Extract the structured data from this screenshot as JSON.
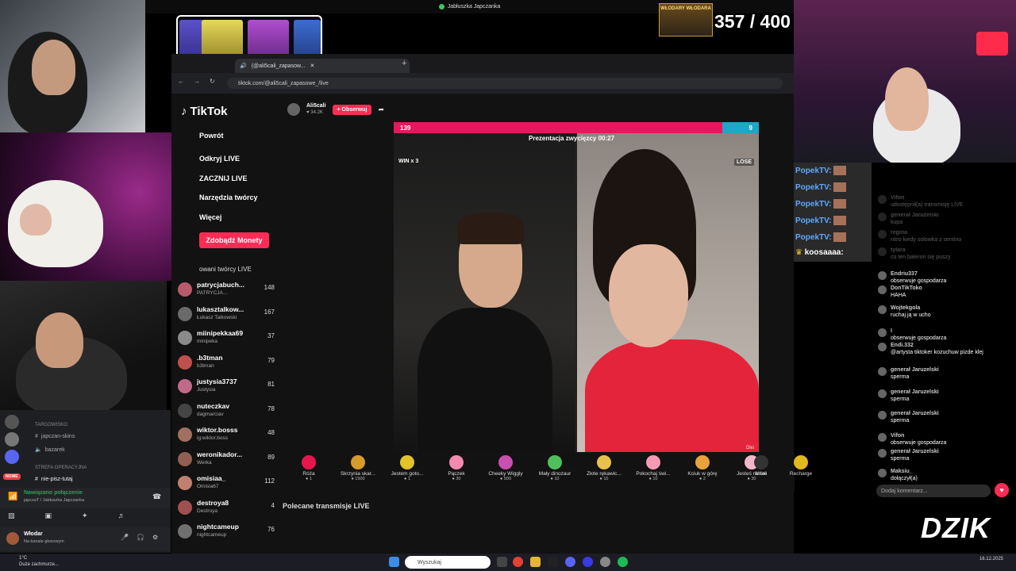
{
  "window_title": "Jabłuszka Japczanka",
  "counter": "357 / 400",
  "wlodary_logo": "WŁODARY WŁODARA",
  "browser": {
    "tab_title": "(@ali5cali_zapasow...",
    "url": "tiktok.com/@ali5cali_zapasowe_/live",
    "new_tab": "+"
  },
  "tiktok": {
    "logo": "TikTok",
    "nav": [
      "Powrót",
      "Odkryj LIVE",
      "ZACZNIJ LIVE",
      "Narzędzia twórcy",
      "Więcej"
    ],
    "coins_button": "Zdobądź Monety",
    "followed_header": "owani twórcy LIVE",
    "creators": [
      {
        "name": "patrycjabuch...",
        "sub": "PATRYCJA...",
        "count": "148"
      },
      {
        "name": "lukasztalkow...",
        "sub": "Łukasz Talkowski",
        "count": "167"
      },
      {
        "name": "miinipekkaa69",
        "sub": "minipeka",
        "count": "37"
      },
      {
        "name": ".b3tman",
        "sub": "b3tman",
        "count": "79"
      },
      {
        "name": "justysia3737",
        "sub": "Justysia",
        "count": "81"
      },
      {
        "name": "nuteczkav",
        "sub": "dagmarciav",
        "count": "78"
      },
      {
        "name": "wiktor.bosss",
        "sub": "ig:wiktor.boss",
        "count": "48"
      },
      {
        "name": "weronikador...",
        "sub": "Werka",
        "count": "89"
      },
      {
        "name": "omisiaa_",
        "sub": "Omisia67",
        "count": "112"
      },
      {
        "name": "destroya8",
        "sub": "Destroya",
        "count": "4"
      },
      {
        "name": "nightcameup",
        "sub": "nightcameup",
        "count": "76"
      }
    ],
    "streamer": {
      "name": "Ali5cali",
      "viewers": "34.2K",
      "follow": "+ Obserwuj"
    },
    "battle": {
      "score_left": "139",
      "score_right": "9",
      "title": "Prezentacja zwycięzcy 00:27",
      "win": "WIN x 3",
      "lose": "LOSE",
      "watermark": "Dixi"
    },
    "gifts": [
      {
        "name": "Róża",
        "price": "1",
        "color": "#e6174d"
      },
      {
        "name": "Skrzynia skar...",
        "price": "1500",
        "color": "#d69b2b"
      },
      {
        "name": "Jestem goto...",
        "price": "1",
        "color": "#e2c22a"
      },
      {
        "name": "Pączek",
        "price": "30",
        "color": "#f28ab0"
      },
      {
        "name": "Cheeky Wiggly",
        "price": "500",
        "color": "#c94fb0"
      },
      {
        "name": "Mały dinozaur",
        "price": "10",
        "color": "#4fbf5c"
      },
      {
        "name": "Złote rękawic...",
        "price": "10",
        "color": "#e8c14a"
      },
      {
        "name": "Pokochaj świ...",
        "price": "10",
        "color": "#f59ab5"
      },
      {
        "name": "Kciuk w górę",
        "price": "2",
        "color": "#e8a33a"
      },
      {
        "name": "Jesteś na fali",
        "price": "30",
        "color": "#f2b7c9"
      }
    ],
    "more": "More",
    "recharge": "Recharge",
    "recommended": "Polecane transmisje LIVE"
  },
  "popek_chat": {
    "user": "PopekTV:",
    "lines": 5,
    "last": "koosaaaa:"
  },
  "tt_chat": [
    {
      "user": "Vifon",
      "text": "udostępnił(a) transmisję LIVE"
    },
    {
      "user": "generał Jaruzelski",
      "text": "kupa"
    },
    {
      "user": "regina",
      "text": "nitro kiedy solowka z sentino"
    },
    {
      "user": "tylara",
      "text": "co ten baleron się puszy"
    },
    {
      "user": "Endriu337",
      "text": "obserwuje gospodarza"
    },
    {
      "user": "DonTikToko",
      "text": "HAHA"
    },
    {
      "user": "Wojtekgola",
      "text": "ruchaj ją w ucho"
    },
    {
      "user": "I",
      "text": "obserwuje gospodarza"
    },
    {
      "user": "Endi.332",
      "text": "@artysta tiktoker kozuchuw pizde klej"
    },
    {
      "user": "generał Jaruzelski",
      "text": "sperma"
    },
    {
      "user": "generał Jaruzelski",
      "text": "sperma"
    },
    {
      "user": "generał Jaruzelski",
      "text": "sperma"
    },
    {
      "user": "Vifon",
      "text": "obserwuje gospodarza"
    },
    {
      "user": "generał Jaruzelski",
      "text": "sperma"
    },
    {
      "user": "Maksiu_",
      "text": "dołączył(a)"
    }
  ],
  "comment_placeholder": "Dodaj komentarz...",
  "discord": {
    "cat1": "TARGOWISKO",
    "ch1": "japczan-skins",
    "ch2": "bazarek",
    "cat2": "STREFA OPERACYJNA",
    "ch3": "nie-pisz-tutaj",
    "conn": "Nawiązano połączenie",
    "conn_sub": "japczaT / Jabłuszka Japczanka",
    "user": "Włodar",
    "user_status": "Na kanale głosowym",
    "badge": "NOWE"
  },
  "dzik": "DZIK",
  "taskbar": {
    "search": "Wyszukaj",
    "weather_temp": "1°C",
    "weather_desc": "Duże zachmurze...",
    "date": "16.12.2025"
  }
}
